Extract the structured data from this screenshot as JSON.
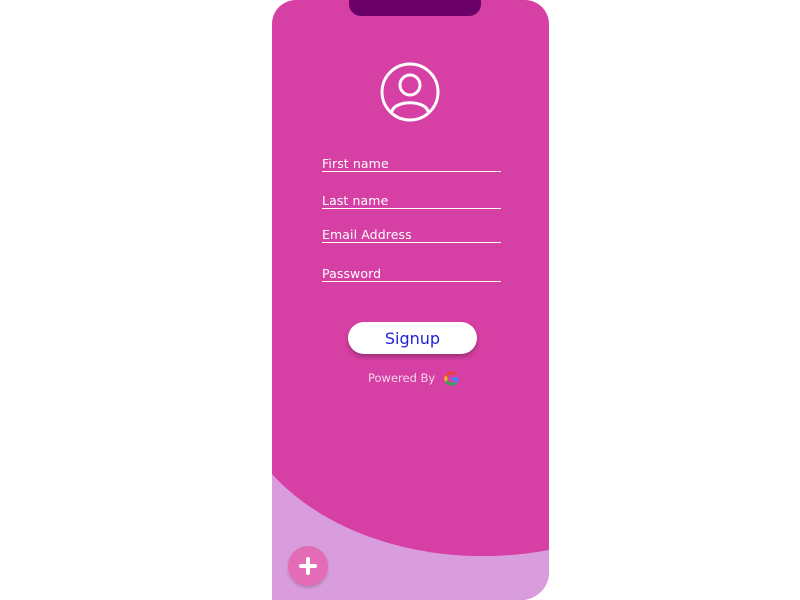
{
  "form": {
    "fields": [
      {
        "label": "First name"
      },
      {
        "label": "Last name"
      },
      {
        "label": "Email Address"
      },
      {
        "label": "Password"
      }
    ],
    "signup_label": "Signup",
    "powered_by_label": "Powered By"
  },
  "icons": {
    "avatar": "user-circle-icon",
    "google": "google-icon",
    "fab": "plus-icon"
  },
  "colors": {
    "card": "#d63fa3",
    "notch": "#6a0068",
    "swoosh": "#d99ddd",
    "button_text": "#1f1fd6",
    "fab": "#e46cb6"
  }
}
